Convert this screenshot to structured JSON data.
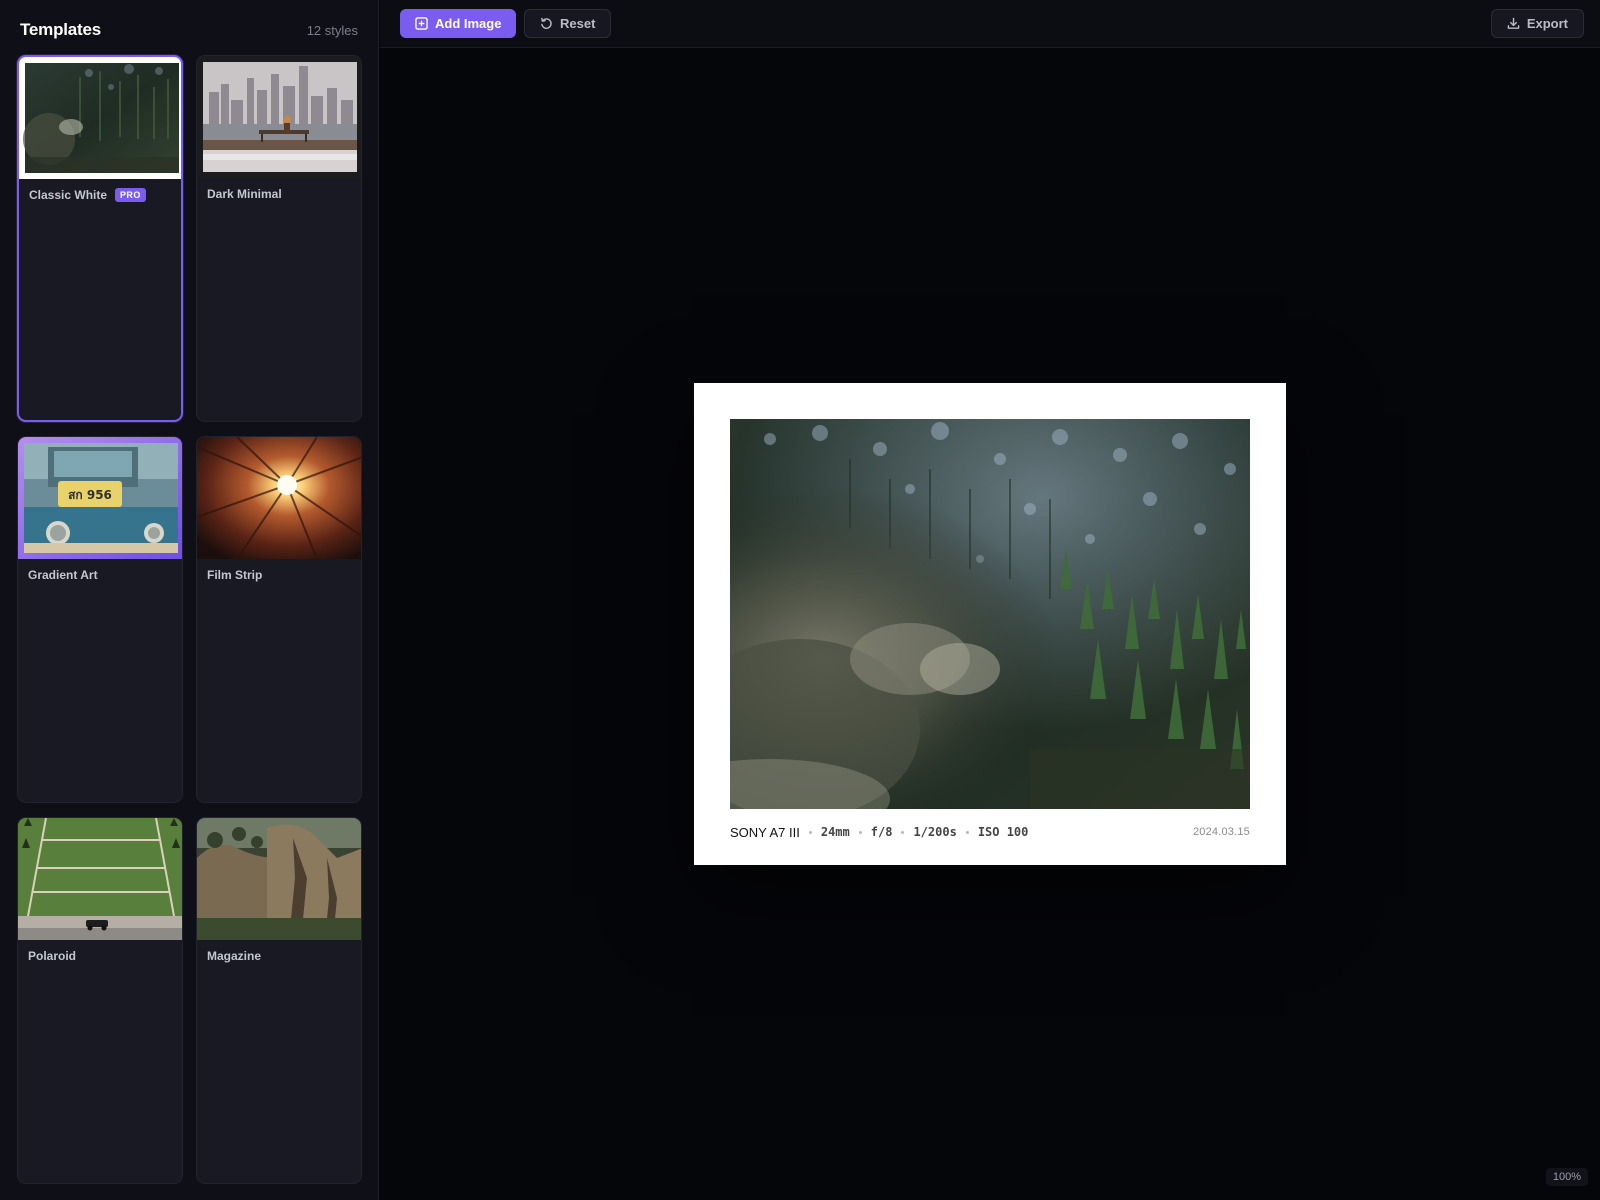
{
  "sidebar": {
    "title": "Templates",
    "count": "12 styles",
    "templates": [
      {
        "label": "Classic White",
        "badge": "PRO",
        "selected": true,
        "thumb": "forest-aerial"
      },
      {
        "label": "Dark Minimal",
        "badge": "",
        "selected": false,
        "thumb": "city-skyline"
      },
      {
        "label": "Gradient Art",
        "badge": "",
        "selected": false,
        "thumb": "vintage-car"
      },
      {
        "label": "Film Strip",
        "badge": "",
        "selected": false,
        "thumb": "sun-building"
      },
      {
        "label": "Polaroid",
        "badge": "",
        "selected": false,
        "thumb": "green-field"
      },
      {
        "label": "Magazine",
        "badge": "",
        "selected": false,
        "thumb": "rock-cliffs"
      }
    ]
  },
  "toolbar": {
    "add_image_label": "Add Image",
    "reset_label": "Reset",
    "export_label": "Export"
  },
  "preview": {
    "camera": "SONY A7 III",
    "focal": "24mm",
    "aperture": "f/8",
    "shutter": "1/200s",
    "iso": "ISO 100",
    "date": "2024.03.15"
  },
  "zoom": "100%",
  "colors": {
    "accent": "#7b5cf0",
    "sidebar_bg": "#0f1017",
    "canvas_bg": "#05060a",
    "card_bg": "#181922"
  }
}
